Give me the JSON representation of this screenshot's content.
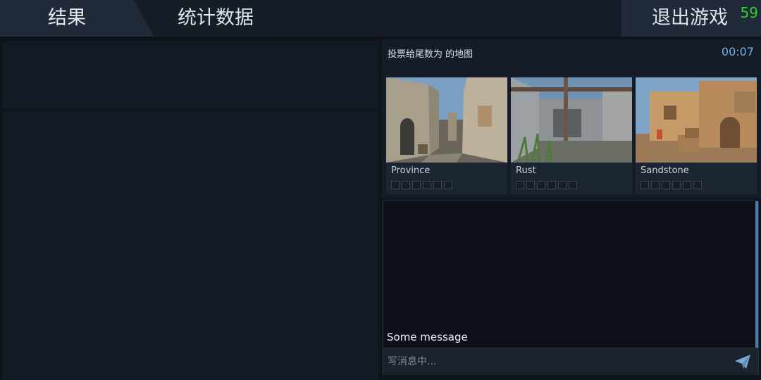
{
  "tabs": [
    {
      "label": "结果",
      "active": true
    },
    {
      "label": "统计数据",
      "active": false
    }
  ],
  "exit": {
    "label": "退出游戏"
  },
  "counter": "59",
  "vote": {
    "title": "投票给尾数为 的地图",
    "timer": "00:07",
    "maps": [
      {
        "name": "Province",
        "vote_slots": 6
      },
      {
        "name": "Rust",
        "vote_slots": 6
      },
      {
        "name": "Sandstone",
        "vote_slots": 6
      }
    ]
  },
  "chat": {
    "messages": [
      "Some message"
    ],
    "input_value": "",
    "placeholder": "写消息中...",
    "send_icon": "paper-plane-icon"
  },
  "colors": {
    "accent": "#6fb0e8",
    "counter": "#2fd12f",
    "topbar": "#161d27",
    "active_tab": "#202a38"
  }
}
